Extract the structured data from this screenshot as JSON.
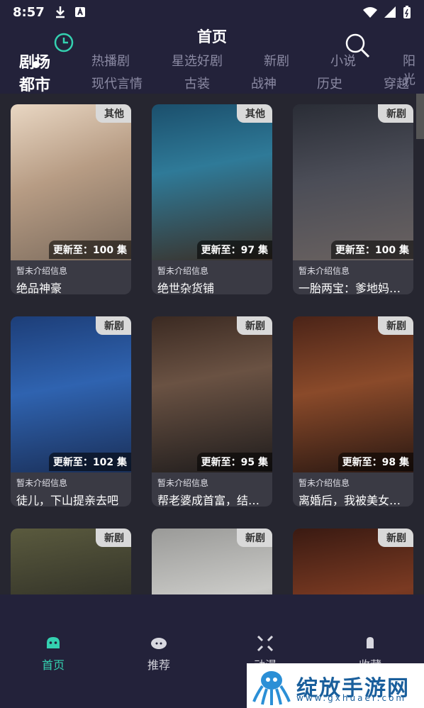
{
  "status": {
    "time": "8:57"
  },
  "header": {
    "title": "首页",
    "tabs_row1": [
      "剧场",
      "热播剧",
      "星选好剧",
      "新剧",
      "小说",
      "阳光"
    ],
    "tabs_row2": [
      "都市",
      "现代言情",
      "古装",
      "战神",
      "历史",
      "穿越"
    ]
  },
  "cards": [
    {
      "badge": "其他",
      "update": "更新至：100 集",
      "intro": "暂未介绍信息",
      "name": "绝品神豪"
    },
    {
      "badge": "其他",
      "update": "更新至：97 集",
      "intro": "暂未介绍信息",
      "name": "绝世杂货铺"
    },
    {
      "badge": "新剧",
      "update": "更新至：100 集",
      "intro": "暂未介绍信息",
      "name": "一胎两宝：爹地妈咪..."
    },
    {
      "badge": "新剧",
      "update": "更新至：102 集",
      "intro": "暂未介绍信息",
      "name": "徒儿，下山提亲去吧"
    },
    {
      "badge": "新剧",
      "update": "更新至：95 集",
      "intro": "暂未介绍信息",
      "name": "帮老婆成首富，结果..."
    },
    {
      "badge": "新剧",
      "update": "更新至：98 集",
      "intro": "暂未介绍信息",
      "name": "离婚后，我被美女包..."
    },
    {
      "badge": "新剧",
      "update": "",
      "intro": "",
      "name": ""
    },
    {
      "badge": "新剧",
      "update": "",
      "intro": "",
      "name": ""
    },
    {
      "badge": "新剧",
      "update": "",
      "intro": "",
      "name": ""
    }
  ],
  "bottom_nav": [
    {
      "label": "首页",
      "icon": "home-icon"
    },
    {
      "label": "推荐",
      "icon": "recommend-icon"
    },
    {
      "label": "动漫",
      "icon": "anime-icon"
    },
    {
      "label": "收藏",
      "icon": "favorite-icon"
    }
  ],
  "watermark": {
    "title": "绽放手游网",
    "url": "www.gxhuaer.com"
  },
  "colors": {
    "accent": "#34d1b0",
    "header_bg": "#23223a",
    "page_bg": "#262630"
  }
}
